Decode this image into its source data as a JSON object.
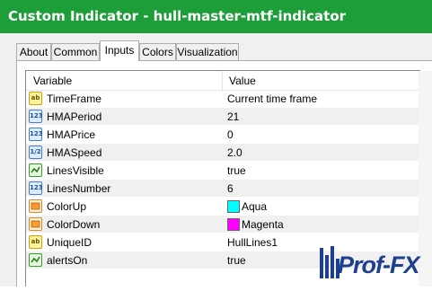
{
  "window": {
    "title": "Custom Indicator - hull-master-mtf-indicator"
  },
  "tabs": [
    {
      "label": "About"
    },
    {
      "label": "Common"
    },
    {
      "label": "Inputs",
      "active": true
    },
    {
      "label": "Colors"
    },
    {
      "label": "Visualization"
    }
  ],
  "table": {
    "columns": [
      "Variable",
      "Value"
    ],
    "rows": [
      {
        "icon": "string-type-icon",
        "type_glyph": "ab",
        "variable": "TimeFrame",
        "value": "Current time frame"
      },
      {
        "icon": "integer-type-icon",
        "type_glyph": "123",
        "variable": "HMAPeriod",
        "value": "21"
      },
      {
        "icon": "integer-type-icon",
        "type_glyph": "123",
        "variable": "HMAPrice",
        "value": "0"
      },
      {
        "icon": "double-type-icon",
        "type_glyph": "1/2",
        "variable": "HMASpeed",
        "value": "2.0"
      },
      {
        "icon": "bool-type-icon",
        "type_glyph": "",
        "variable": "LinesVisible",
        "value": "true"
      },
      {
        "icon": "integer-type-icon",
        "type_glyph": "123",
        "variable": "LinesNumber",
        "value": "6"
      },
      {
        "icon": "color-type-icon",
        "type_glyph": "",
        "variable": "ColorUp",
        "value": "Aqua",
        "swatch": "#00ffff"
      },
      {
        "icon": "color-type-icon",
        "type_glyph": "",
        "variable": "ColorDown",
        "value": "Magenta",
        "swatch": "#ff00ff"
      },
      {
        "icon": "string-type-icon",
        "type_glyph": "ab",
        "variable": "UniqueID",
        "value": "HullLines1"
      },
      {
        "icon": "bool-type-icon",
        "type_glyph": "",
        "variable": "alertsOn",
        "value": "true"
      }
    ]
  },
  "watermark": {
    "text": "Prof-FX"
  },
  "colors": {
    "titlebar": "#1e9e38",
    "watermark": "#1c3f8e"
  }
}
